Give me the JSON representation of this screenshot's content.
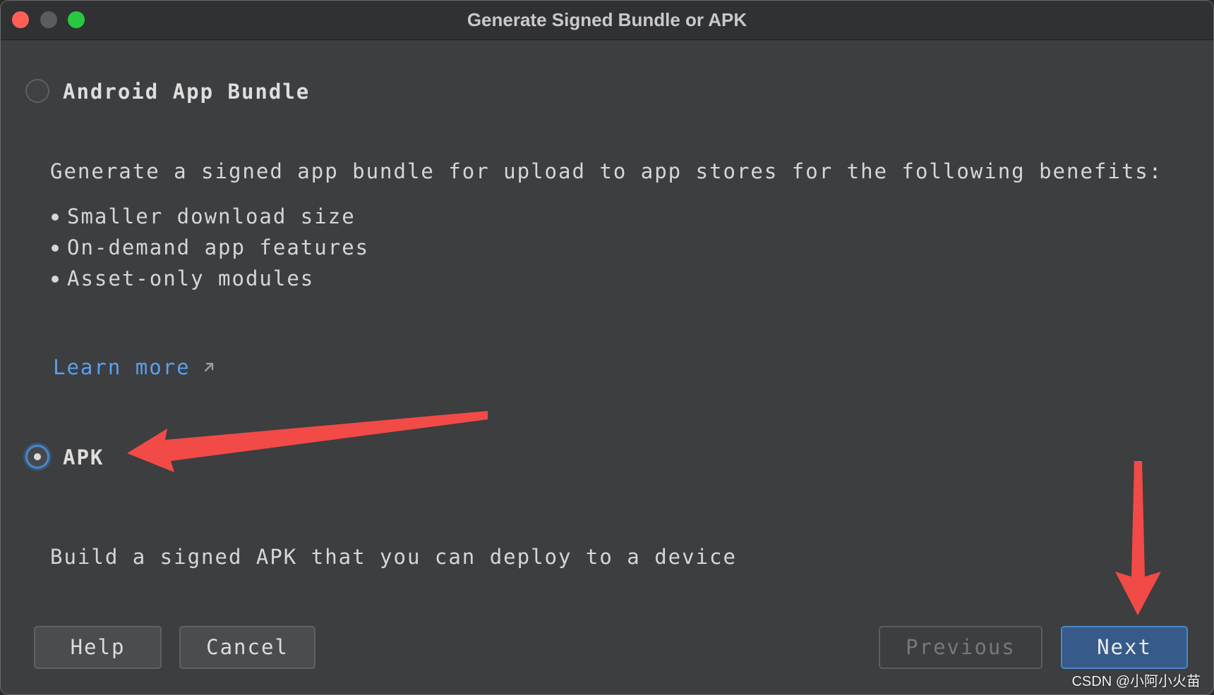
{
  "window": {
    "title": "Generate Signed Bundle or APK"
  },
  "options": [
    {
      "label": "Android App Bundle",
      "selected": false,
      "description": "Generate a signed app bundle for upload to app stores for the following benefits:",
      "benefits": [
        "Smaller download size",
        "On-demand app features",
        "Asset-only modules"
      ],
      "link": "Learn more"
    },
    {
      "label": "APK",
      "selected": true,
      "description": "Build a signed APK that you can deploy to a device"
    }
  ],
  "buttons": {
    "help": "Help",
    "cancel": "Cancel",
    "previous": "Previous",
    "next": "Next"
  },
  "watermark": "CSDN @小阿小火苗",
  "colors": {
    "background": "#3c3e40",
    "titlebar": "#303133",
    "accent": "#4a88c7",
    "primary_button": "#365a8a",
    "link": "#5c9ff0",
    "annotation": "#f24a47"
  },
  "icons": {
    "link_icon": "external-link-icon",
    "bullet": "bullet-icon",
    "annotation": "red-arrow-icon"
  }
}
